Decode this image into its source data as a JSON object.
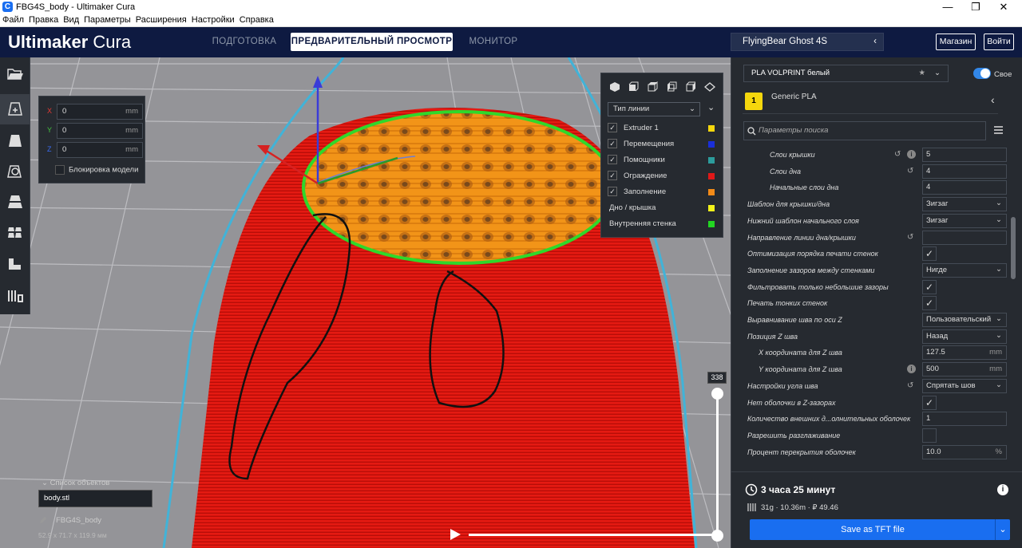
{
  "window": {
    "title": "FBG4S_body - Ultimaker Cura",
    "minimize": "—",
    "maximize": "❐",
    "close": "✕",
    "app_icon": "C"
  },
  "menu": [
    "Файл",
    "Правка",
    "Вид",
    "Параметры",
    "Расширения",
    "Настройки",
    "Справка"
  ],
  "header": {
    "logo_bold": "Ultimaker",
    "logo_light": " Cura",
    "tabs": [
      "ПОДГОТОВКА",
      "ПРЕДВАРИТЕЛЬНЫЙ ПРОСМОТР",
      "МОНИТОР"
    ],
    "active_tab": 1,
    "printer": "FlyingBear Ghost 4S",
    "marketplace": "Магазин",
    "signin": "Войти"
  },
  "move_panel": {
    "x": {
      "label": "X",
      "value": "0",
      "unit": "mm",
      "color": "#e53935"
    },
    "y": {
      "label": "Y",
      "value": "0",
      "unit": "mm",
      "color": "#43c43e"
    },
    "z": {
      "label": "Z",
      "value": "0",
      "unit": "mm",
      "color": "#3a6cf0"
    },
    "lock_label": "Блокировка модели"
  },
  "view_panel": {
    "color_scheme": "Тип линии",
    "legend": [
      {
        "label": "Extruder 1",
        "checked": true,
        "color": "#f5d70d",
        "icon": "extruder-icon"
      },
      {
        "label": "Перемещения",
        "checked": true,
        "color": "#1a2fd9"
      },
      {
        "label": "Помощники",
        "checked": true,
        "color": "#2c9c9c"
      },
      {
        "label": "Ограждение",
        "checked": true,
        "color": "#e01818"
      },
      {
        "label": "Заполнение",
        "checked": true,
        "color": "#f28a18"
      },
      {
        "label": "Дно / крышка",
        "checked": false,
        "color": "#f2f21a"
      },
      {
        "label": "Внутренняя стенка",
        "checked": false,
        "color": "#22d622"
      }
    ]
  },
  "objects": {
    "list_label": "Список объектов",
    "item": "body.stl",
    "job_name": "FBG4S_body",
    "dimensions": "52.9 x 71.7 x 119.9 мм"
  },
  "layer_slider": {
    "current": "338"
  },
  "right_panel": {
    "material": "PLA VOLPRINT белый",
    "custom_label": "Свое",
    "extruder_number": "1",
    "extruder_material": "Generic PLA",
    "search_placeholder": "Параметры поиска",
    "settings": [
      {
        "label": "Слои крышки",
        "kind": "field",
        "value": "5",
        "indent": 2,
        "reset": true,
        "info": true
      },
      {
        "label": "Слои дна",
        "kind": "field",
        "value": "4",
        "indent": 2,
        "reset": true
      },
      {
        "label": "Начальные слои дна",
        "kind": "field",
        "value": "4",
        "indent": 2
      },
      {
        "label": "Шаблон для крышки/дна",
        "kind": "select",
        "value": "Зигзаг",
        "indent": 0
      },
      {
        "label": "Нижний шаблон начального слоя",
        "kind": "select",
        "value": "Зигзаг",
        "indent": 0
      },
      {
        "label": "Направление линии дна/крышки",
        "kind": "field",
        "value": "",
        "indent": 0,
        "reset": true
      },
      {
        "label": "Оптимизация порядка печати стенок",
        "kind": "check",
        "value": true,
        "indent": 0
      },
      {
        "label": "Заполнение зазоров между стенками",
        "kind": "select",
        "value": "Нигде",
        "indent": 0
      },
      {
        "label": "Фильтровать только небольшие зазоры",
        "kind": "check",
        "value": true,
        "indent": 0
      },
      {
        "label": "Печать тонких стенок",
        "kind": "check",
        "value": true,
        "indent": 0
      },
      {
        "label": "Выравнивание шва по оси Z",
        "kind": "select",
        "value": "Пользовательский",
        "indent": 0
      },
      {
        "label": "Позиция Z шва",
        "kind": "select",
        "value": "Назад",
        "indent": 0
      },
      {
        "label": "X координата для Z шва",
        "kind": "field",
        "value": "127.5",
        "unit": "mm",
        "indent": 1
      },
      {
        "label": "Y координата для Z шва",
        "kind": "field",
        "value": "500",
        "unit": "mm",
        "indent": 1,
        "info": true
      },
      {
        "label": "Настройки угла шва",
        "kind": "select",
        "value": "Спрятать шов",
        "indent": 0,
        "reset": true
      },
      {
        "label": "Нет оболочки в Z-зазорах",
        "kind": "check",
        "value": true,
        "indent": 0
      },
      {
        "label": "Количество внешних д...олнительных оболочек",
        "kind": "field",
        "value": "1",
        "indent": 0
      },
      {
        "label": "Разрешить разглаживание",
        "kind": "check",
        "value": false,
        "indent": 0
      },
      {
        "label": "Процент перекрытия оболочек",
        "kind": "field",
        "value": "10.0",
        "unit": "%",
        "indent": 0
      }
    ]
  },
  "print": {
    "time": "3 часа 25 минут",
    "stats": "31g · 10.36m · ₽ 49.46",
    "save_label": "Save as TFT file"
  }
}
